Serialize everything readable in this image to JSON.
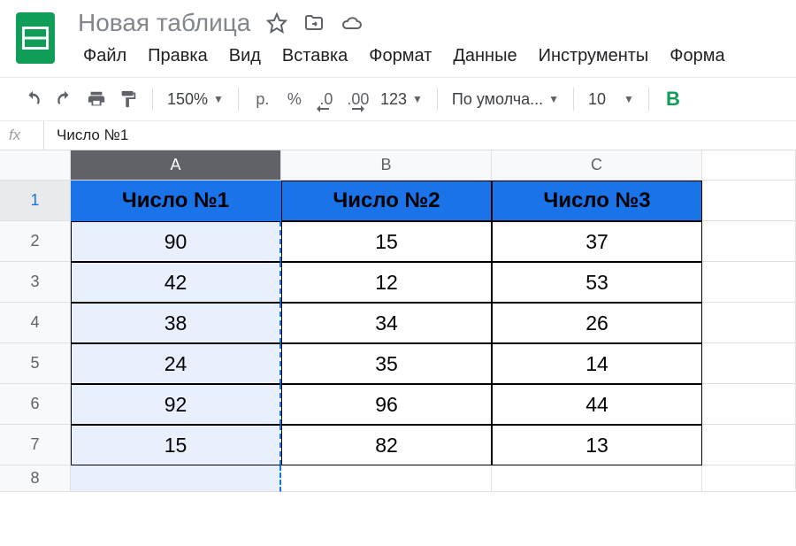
{
  "doc": {
    "title": "Новая таблица"
  },
  "menu": {
    "file": "Файл",
    "edit": "Правка",
    "view": "Вид",
    "insert": "Вставка",
    "format": "Формат",
    "data": "Данные",
    "tools": "Инструменты",
    "form": "Форма"
  },
  "toolbar": {
    "zoom": "150%",
    "currency": "р.",
    "percent": "%",
    "dec_dec": ".0",
    "inc_dec": ".00",
    "numfmt": "123",
    "font": "По умолча...",
    "fontsize": "10",
    "bold": "B"
  },
  "formula": {
    "label": "fx",
    "value": "Число №1"
  },
  "columns": [
    "A",
    "B",
    "C"
  ],
  "rows": [
    "1",
    "2",
    "3",
    "4",
    "5",
    "6",
    "7",
    "8"
  ],
  "selected_column": "A",
  "active_cell": "A1",
  "chart_data": {
    "type": "table",
    "headers": [
      "Число №1",
      "Число №2",
      "Число №3"
    ],
    "rows": [
      [
        90,
        15,
        37
      ],
      [
        42,
        12,
        53
      ],
      [
        38,
        34,
        26
      ],
      [
        24,
        35,
        14
      ],
      [
        92,
        96,
        44
      ],
      [
        15,
        82,
        13
      ]
    ]
  }
}
